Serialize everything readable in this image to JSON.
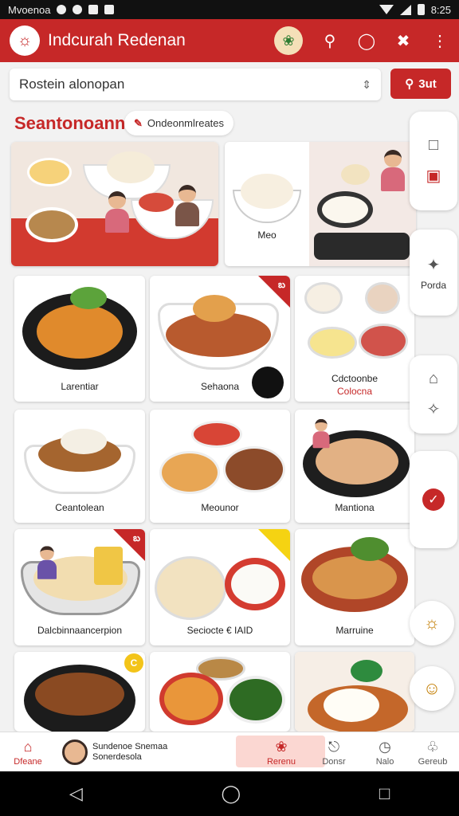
{
  "status_bar": {
    "left_text": "Mvoenoa",
    "time": "8:25"
  },
  "app_bar": {
    "title": "Indcurah Redenan",
    "logo_glyph": "☼",
    "mascot_glyph": "❀"
  },
  "search": {
    "value": "Rostein alonopan",
    "button_label": "3ut"
  },
  "section": {
    "title": "Seantonoann",
    "chip_label": "Ondeonmlreates"
  },
  "cards": [
    {
      "caption": "",
      "badge": ""
    },
    {
      "caption": "Meo",
      "badge": ""
    },
    {
      "caption": "Larentiar",
      "badge": ""
    },
    {
      "caption": "Sehaona",
      "badge": "బ"
    },
    {
      "caption": "Cdctoonbe",
      "caption2": "Colocna",
      "badge": ""
    },
    {
      "caption": "Ceantolean",
      "badge": ""
    },
    {
      "caption": "Meounor",
      "badge": ""
    },
    {
      "caption": "Mantiona",
      "badge": ""
    },
    {
      "caption": "Dalcbinnaancerpion",
      "badge": "బ"
    },
    {
      "caption": "Seciocte € IAID",
      "badge": ""
    },
    {
      "caption": "Marruine",
      "badge": ""
    },
    {
      "caption": "",
      "badge": "C"
    },
    {
      "caption": "",
      "badge": ""
    },
    {
      "caption": "",
      "badge": ""
    }
  ],
  "rail": {
    "label": "Porda"
  },
  "bottom_nav": {
    "home": "Dfeane",
    "promo": "Sundenoe Snemaa Sonerdesola",
    "recent": "Rerenu",
    "item3": "Donsr",
    "item4": "Nalo",
    "item5": "Gereub"
  },
  "colors": {
    "accent": "#c62828",
    "highlight": "#fbd7d2"
  }
}
